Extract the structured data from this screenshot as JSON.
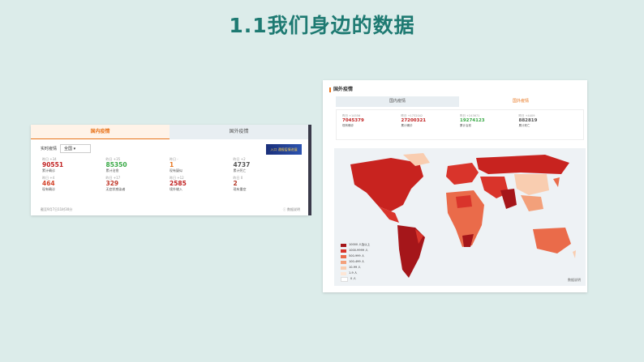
{
  "slide": {
    "title": "1.1我们身边的数据"
  },
  "domestic": {
    "tabs": [
      "国内疫情",
      "国外疫情"
    ],
    "filter_label": "实时疫情",
    "region_value": "全国",
    "banner": "入口 通报疫情进展",
    "stats": [
      {
        "delta": "昨日 +34",
        "value": "90551",
        "label": "累计确诊",
        "color": "#c01f1f"
      },
      {
        "delta": "昨日 +35",
        "value": "85350",
        "label": "累计治愈",
        "color": "#37a844"
      },
      {
        "delta": "昨日 -",
        "value": "1",
        "label": "现有疑似",
        "color": "#e8741c"
      },
      {
        "delta": "昨日 +2",
        "value": "4737",
        "label": "累计死亡",
        "color": "#555555"
      },
      {
        "delta": "昨日 +4",
        "value": "464",
        "label": "现有确诊",
        "color": "#d4452c"
      },
      {
        "delta": "昨日 +17",
        "value": "329",
        "label": "无症状感染者",
        "color": "#c0392b"
      },
      {
        "delta": "昨日 +12",
        "value": "2585",
        "label": "境外输入",
        "color": "#c01f1f"
      },
      {
        "delta": "昨日 0",
        "value": "2",
        "label": "现有重症",
        "color": "#b43a2a"
      }
    ],
    "footer": "截至9月7日11时30分",
    "source": "数据说明"
  },
  "foreign": {
    "section_title": "国外疫情",
    "tabs": [
      "国内疫情",
      "国外疫情"
    ],
    "stats": [
      {
        "delta": "昨日 +14556",
        "value": "7045379",
        "label": "现有确诊",
        "color": "#c01f1f"
      },
      {
        "delta": "昨日 +1732042",
        "value": "27200321",
        "label": "累计确诊",
        "color": "#c01f1f"
      },
      {
        "delta": "昨日 +243671",
        "value": "19274123",
        "label": "累计治愈",
        "color": "#37a844"
      },
      {
        "delta": "昨日 +4409",
        "value": "882819",
        "label": "累计死亡",
        "color": "#555555"
      }
    ],
    "legend": [
      {
        "label": "10000 人及以上",
        "color": "#a5161a"
      },
      {
        "label": "1000-9999 人",
        "color": "#d9342b"
      },
      {
        "label": "500-999 人",
        "color": "#ea6b4a"
      },
      {
        "label": "100-499 人",
        "color": "#f3a07a"
      },
      {
        "label": "10-99 人",
        "color": "#f9cdb0"
      },
      {
        "label": "1-9 人",
        "color": "#fde6d6"
      },
      {
        "label": "0 人",
        "color": "#ffffff"
      }
    ],
    "map_footer": "数据说明"
  }
}
